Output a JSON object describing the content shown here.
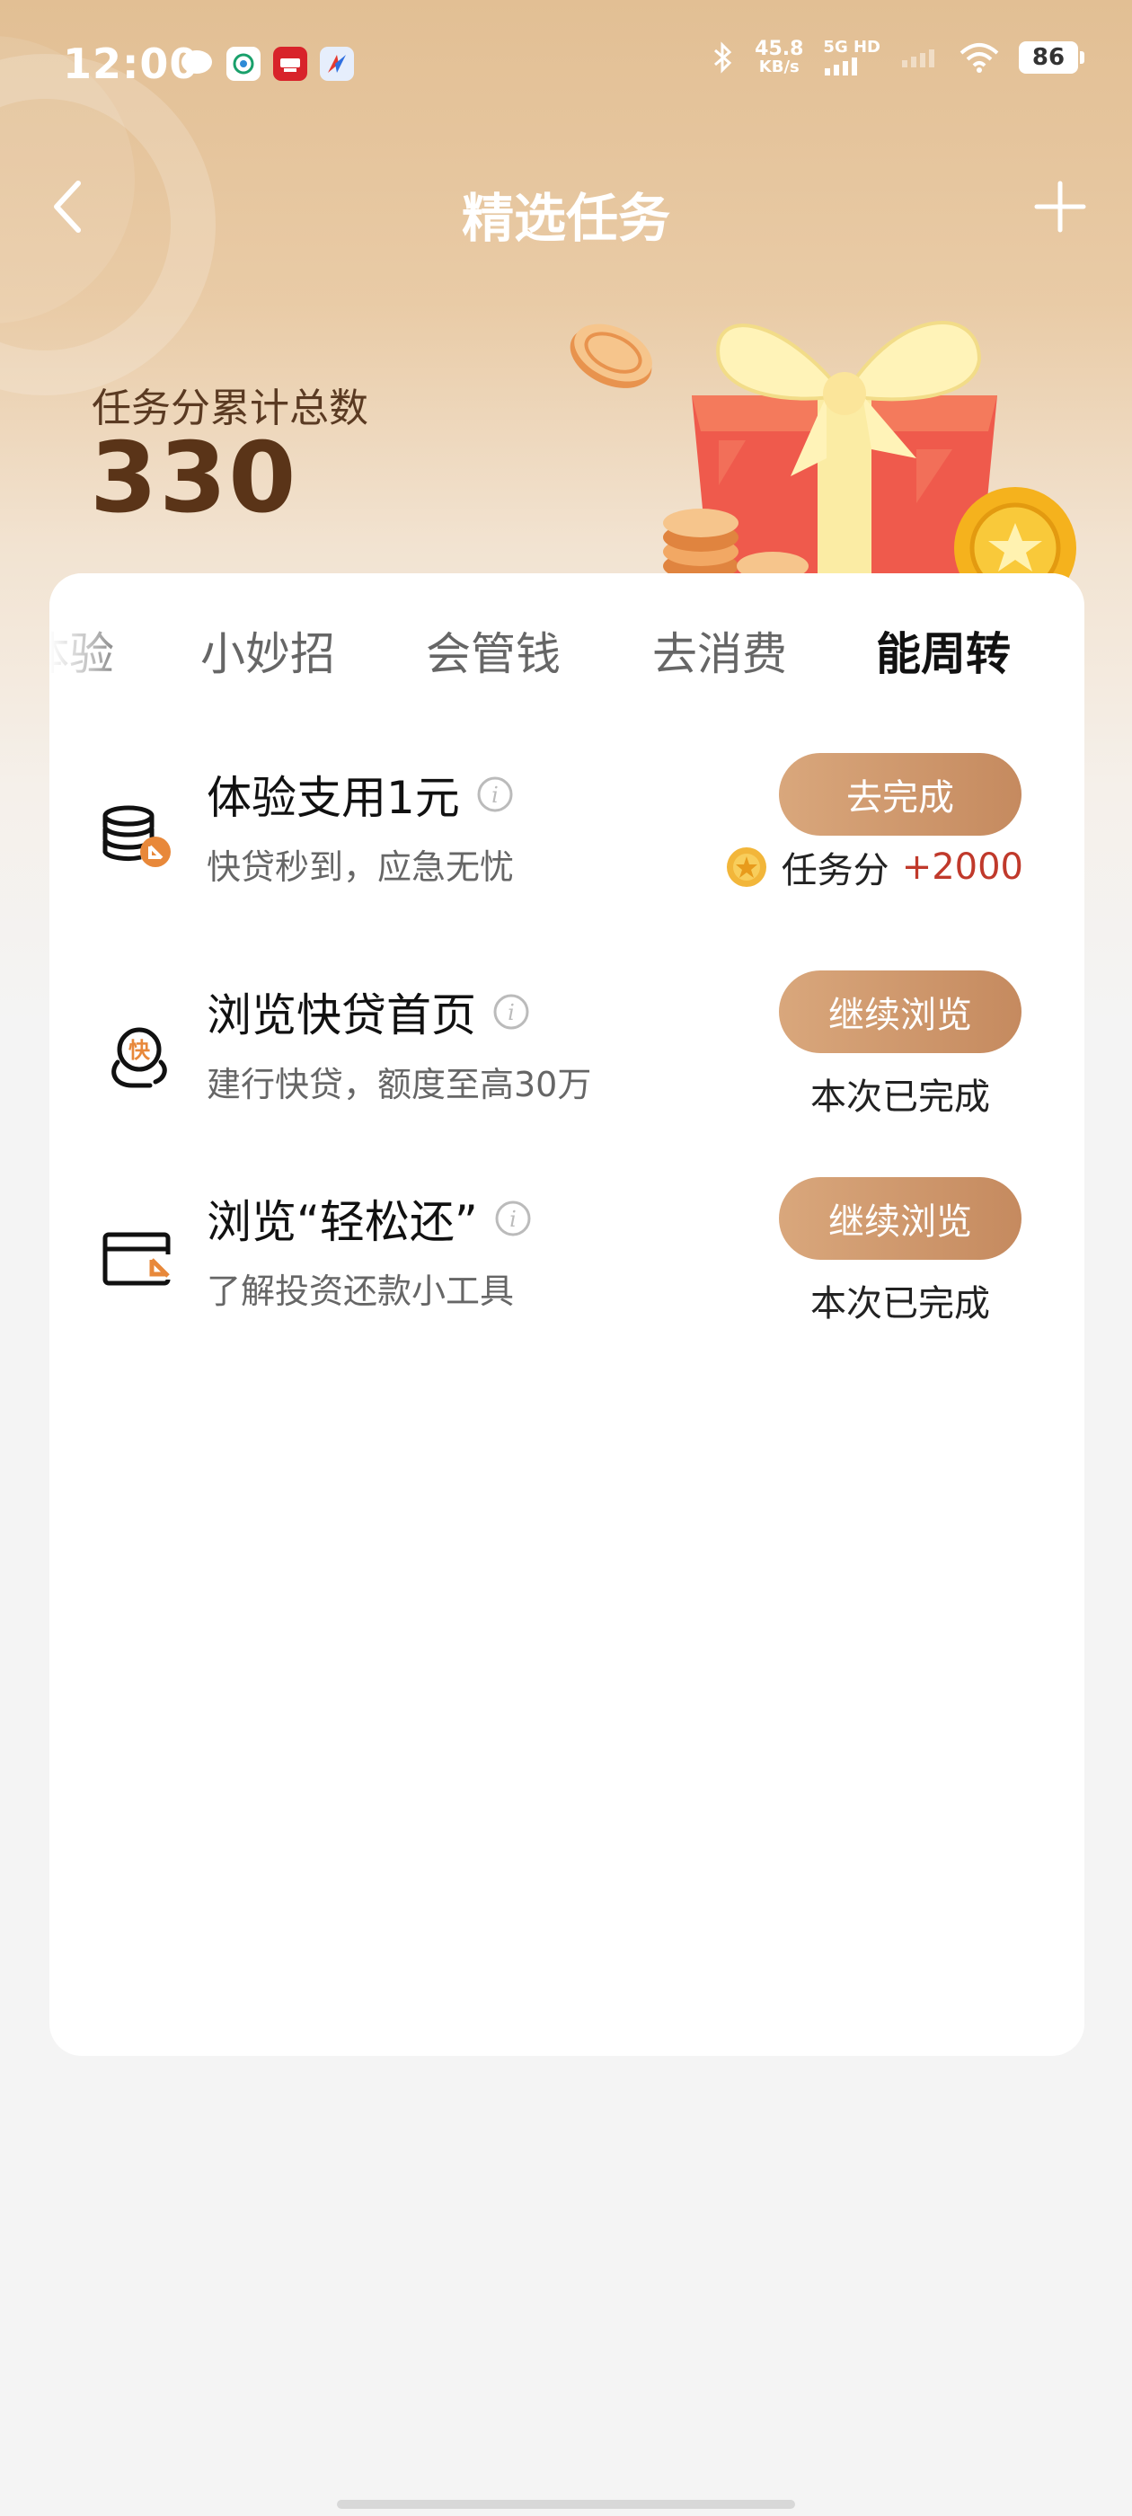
{
  "status_bar": {
    "time": "12:00",
    "net_speed_value": "45.8",
    "net_speed_unit": "KB/s",
    "net_type": "5G HD",
    "battery": "86"
  },
  "header": {
    "title": "精选任务"
  },
  "summary": {
    "label": "任务分累计总数",
    "value": "330"
  },
  "tabs": [
    {
      "label": "体验",
      "active": false
    },
    {
      "label": "小妙招",
      "active": false
    },
    {
      "label": "会管钱",
      "active": false
    },
    {
      "label": "去消费",
      "active": false
    },
    {
      "label": "能周转",
      "active": true
    }
  ],
  "tasks": [
    {
      "title": "体验支用1元",
      "subtitle": "快贷秒到，应急无忧",
      "button": "去完成",
      "reward_label": "任务分",
      "reward_value": "+2000",
      "icon": "coin-stack-icon"
    },
    {
      "title": "浏览快贷首页",
      "subtitle": "建行快贷，额度至高30万",
      "button": "继续浏览",
      "status": "本次已完成",
      "icon": "quick-loan-icon"
    },
    {
      "title": "浏览“轻松还”",
      "subtitle": "了解投资还款小工具",
      "button": "继续浏览",
      "status": "本次已完成",
      "icon": "card-repay-icon"
    }
  ],
  "colors": {
    "accent_button_start": "#d9a77c",
    "accent_button_end": "#c58a5f",
    "reward_red": "#c0392b",
    "icon_orange": "#e8883a"
  }
}
